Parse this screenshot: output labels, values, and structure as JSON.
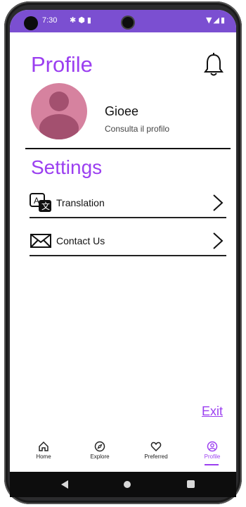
{
  "status_bar": {
    "time": "7:30",
    "left_icons": [
      "settings-icon",
      "shield-icon",
      "card-icon"
    ],
    "right_icons": [
      "wifi-icon",
      "signal-icon",
      "battery-icon"
    ]
  },
  "header": {
    "title": "Profile",
    "notification_icon": "bell-icon"
  },
  "profile": {
    "name": "Gioee",
    "subtitle": "Consulta il profilo"
  },
  "settings": {
    "title": "Settings",
    "items": [
      {
        "label": "Translation",
        "icon": "translate-icon"
      },
      {
        "label": "Contact Us",
        "icon": "mail-icon"
      }
    ]
  },
  "exit_label": "Exit",
  "nav": {
    "items": [
      {
        "label": "Home",
        "icon": "home-icon",
        "active": false
      },
      {
        "label": "Explore",
        "icon": "compass-icon",
        "active": false
      },
      {
        "label": "Preferred",
        "icon": "heart-icon",
        "active": false
      },
      {
        "label": "Profile",
        "icon": "user-circle-icon",
        "active": true
      }
    ]
  },
  "colors": {
    "accent": "#9b3ff0",
    "status_bar": "#7b4fd1",
    "avatar_bg": "#d6829f",
    "avatar_fg": "#a3506f"
  }
}
